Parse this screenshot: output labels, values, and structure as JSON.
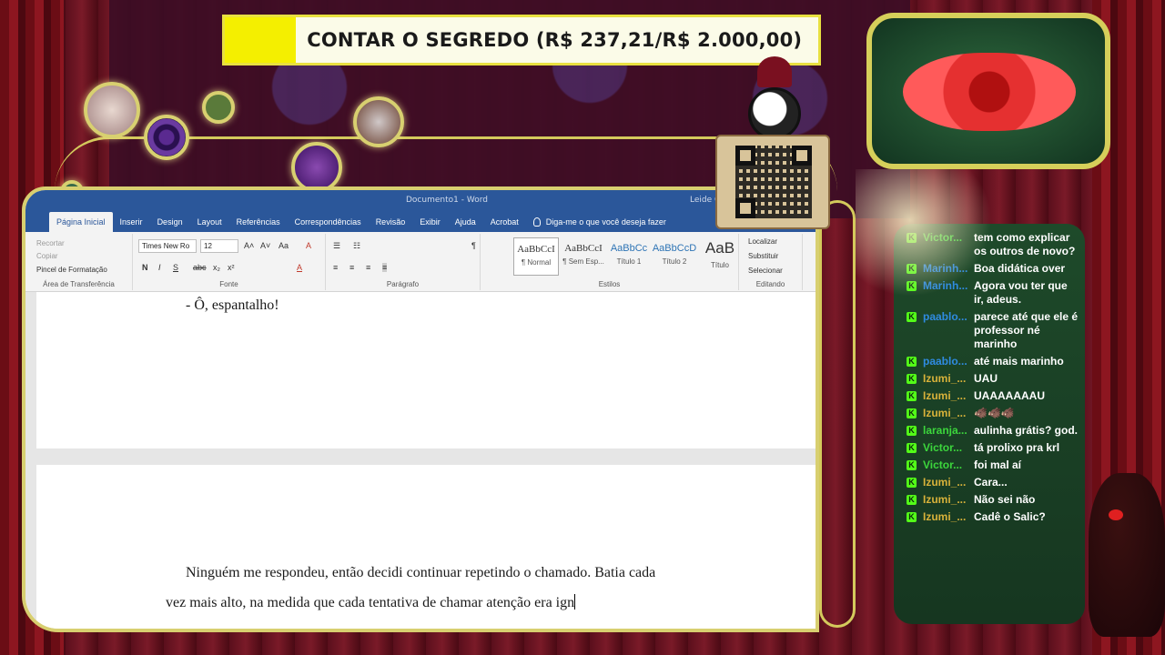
{
  "goal": {
    "text": "CONTAR O SEGREDO (R$ 237,21/R$ 2.000,00)",
    "progress_fraction": 0.1186,
    "fill_color": "#f4ef00"
  },
  "word": {
    "titlebar": {
      "doc_title": "Documento1 - Word",
      "user": "Leide Gon"
    },
    "tabs": [
      "Página Inicial",
      "Inserir",
      "Design",
      "Layout",
      "Referências",
      "Correspondências",
      "Revisão",
      "Exibir",
      "Ajuda",
      "Acrobat"
    ],
    "tell_me": "Diga-me o que você deseja fazer",
    "clipboard": {
      "cut": "Recortar",
      "copy": "Copiar",
      "format_painter": "Pincel de Formatação",
      "label": "Área de Transferência"
    },
    "font": {
      "name": "Times New Ro",
      "size": "12",
      "label": "Fonte",
      "bold": "N",
      "italic": "I",
      "underline": "S",
      "strike": "abc",
      "subscript": "x₂",
      "superscript": "x²",
      "grow": "A˄",
      "shrink": "A˅",
      "case": "Aa",
      "clear": "A"
    },
    "paragraph": {
      "label": "Parágrafo",
      "pilcrow": "¶"
    },
    "styles": {
      "label": "Estilos",
      "items": [
        {
          "sample": "AaBbCcI",
          "name": "¶ Normal"
        },
        {
          "sample": "AaBbCcI",
          "name": "¶ Sem Esp..."
        },
        {
          "sample": "AaBbCc",
          "name": "Título 1"
        },
        {
          "sample": "AaBbCcD",
          "name": "Título 2"
        },
        {
          "sample": "AaB",
          "name": "Título"
        }
      ]
    },
    "editing": {
      "find": "Localizar",
      "replace": "Substituir",
      "select": "Selecionar",
      "label": "Editando"
    },
    "page1_line": "- Ô, espantalho!",
    "page2_line1": "Ninguém me respondeu, então decidi continuar repetindo o chamado. Batia cada",
    "page2_line2": "vez mais alto, na medida que cada tentativa de chamar atenção era ign"
  },
  "chat": {
    "messages": [
      {
        "user": "Victor...",
        "color": "#3cd63c",
        "text": "tem como explicar os outros de novo?"
      },
      {
        "user": "Marinh...",
        "color": "#2f8be0",
        "text": "Boa didática over"
      },
      {
        "user": "Marinh...",
        "color": "#2f8be0",
        "text": "Agora vou ter que ir, adeus."
      },
      {
        "user": "paablo...",
        "color": "#2f8be0",
        "text": "parece até que ele é professor né marinho"
      },
      {
        "user": "paablo...",
        "color": "#2f8be0",
        "text": "até mais marinho"
      },
      {
        "user": "Izumi_...",
        "color": "#d8b23a",
        "text": "UAU"
      },
      {
        "user": "Izumi_...",
        "color": "#d8b23a",
        "text": "UAAAAAAAU"
      },
      {
        "user": "Izumi_...",
        "color": "#d8b23a",
        "text": "🐗🐗🐗"
      },
      {
        "user": "laranja...",
        "color": "#3cd63c",
        "text": "aulinha grátis? god."
      },
      {
        "user": "Victor...",
        "color": "#3cd63c",
        "text": "tá prolixo pra krl"
      },
      {
        "user": "Victor...",
        "color": "#3cd63c",
        "text": "foi mal aí"
      },
      {
        "user": "Izumi_...",
        "color": "#d8b23a",
        "text": "Cara..."
      },
      {
        "user": "Izumi_...",
        "color": "#d8b23a",
        "text": "Não sei não"
      },
      {
        "user": "Izumi_...",
        "color": "#d8b23a",
        "text": "Cadê o Salic?"
      }
    ],
    "badge_letter": "K",
    "badge_color": "#53fc18"
  }
}
